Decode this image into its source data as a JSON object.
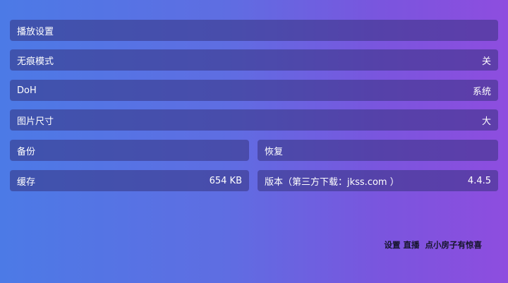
{
  "settings": {
    "playback": {
      "label": "播放设置"
    },
    "incognito": {
      "label": "无痕模式",
      "value": "关"
    },
    "doh": {
      "label": "DoH",
      "value": "系统"
    },
    "image_size": {
      "label": "图片尺寸",
      "value": "大"
    },
    "backup": {
      "label": "备份"
    },
    "restore": {
      "label": "恢复"
    },
    "cache": {
      "label": "缓存",
      "value": "654 KB"
    },
    "version": {
      "label": "版本（第三方下载：jkss.com ）",
      "value": "4.4.5"
    }
  },
  "footer": {
    "settings_link": "设置",
    "live_link": "直播",
    "easter_egg": "点小房子有惊喜"
  }
}
